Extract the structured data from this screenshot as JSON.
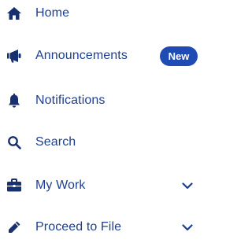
{
  "nav": {
    "items": [
      {
        "label": "Home",
        "icon": "home-icon"
      },
      {
        "label": "Announcements",
        "icon": "megaphone-icon",
        "badge": "New"
      },
      {
        "label": "Notifications",
        "icon": "bell-icon"
      },
      {
        "label": "Search",
        "icon": "search-icon"
      },
      {
        "label": "My Work",
        "icon": "briefcase-icon",
        "expandable": true
      },
      {
        "label": "Proceed to File",
        "icon": "pencil-icon",
        "expandable": true
      }
    ]
  },
  "colors": {
    "text": "#1e3f8f",
    "icon": "#17306e",
    "badge_bg": "#1f4bb5",
    "badge_text": "#ffffff"
  }
}
